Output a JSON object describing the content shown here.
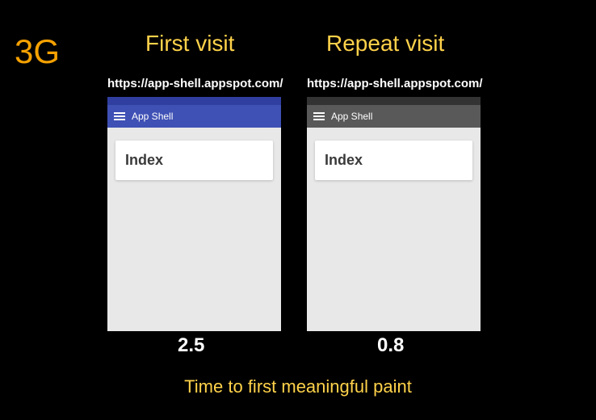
{
  "network_badge": "3G",
  "columns": {
    "first": {
      "heading": "First visit",
      "url": "https://app-shell.appspot.com/",
      "app_title": "App Shell",
      "card_title": "Index",
      "time": "2.5",
      "appbar_color": "#3f51b5",
      "statusbar_color": "#303f9f"
    },
    "repeat": {
      "heading": "Repeat visit",
      "url": "https://app-shell.appspot.com/",
      "app_title": "App Shell",
      "card_title": "Index",
      "time": "0.8",
      "appbar_color": "#595959",
      "statusbar_color": "#333333"
    }
  },
  "footer": "Time to first meaningful paint"
}
